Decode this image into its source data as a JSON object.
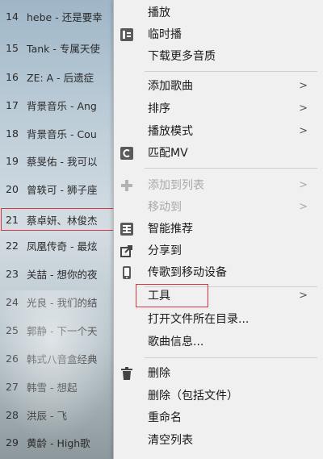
{
  "playlist": {
    "items": [
      {
        "num": "14",
        "text": "hebe - 还是要幸"
      },
      {
        "num": "15",
        "text": "Tank - 专属天使"
      },
      {
        "num": "16",
        "text": "ZE: A - 后遗症"
      },
      {
        "num": "17",
        "text": "背景音乐 - Ang"
      },
      {
        "num": "18",
        "text": "背景音乐 - Cou"
      },
      {
        "num": "19",
        "text": "蔡旻佑 - 我可以"
      },
      {
        "num": "20",
        "text": "曾轶可 - 狮子座"
      },
      {
        "num": "21",
        "text": "蔡卓妍、林俊杰"
      },
      {
        "num": "22",
        "text": "凤凰传奇 - 最炫"
      },
      {
        "num": "23",
        "text": "关喆 - 想你的夜"
      },
      {
        "num": "24",
        "text": "光良 - 我们的结"
      },
      {
        "num": "25",
        "text": "郭静 - 下一个天"
      },
      {
        "num": "26",
        "text": "韩式八音盒经典"
      },
      {
        "num": "27",
        "text": "韩雪 - 想起"
      },
      {
        "num": "28",
        "text": "洪辰 - 飞"
      },
      {
        "num": "29",
        "text": "黄龄 - High歌"
      }
    ]
  },
  "menu": {
    "play": "播放",
    "temp_play": "临时播",
    "download_quality": "下载更多音质",
    "add_song": "添加歌曲",
    "sort": "排序",
    "play_mode": "播放模式",
    "match_mv": "匹配MV",
    "add_to_list": "添加到列表",
    "move_to": "移动到",
    "smart_recommend": "智能推荐",
    "share_to": "分享到",
    "transfer_mobile": "传歌到移动设备",
    "tools": "工具",
    "open_folder": "打开文件所在目录...",
    "song_info": "歌曲信息...",
    "delete": "删除",
    "delete_with_file": "删除（包括文件）",
    "rename": "重命名",
    "clear_list": "清空列表",
    "arrow": ">"
  }
}
